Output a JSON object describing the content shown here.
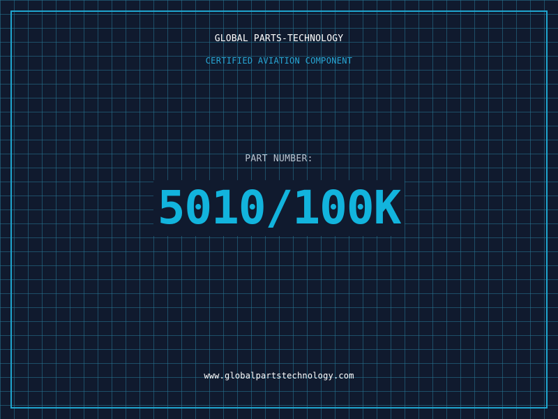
{
  "brand": "GLOBAL PARTS-TECHNOLOGY",
  "subtitle": "CERTIFIED AVIATION COMPONENT",
  "part": {
    "label": "PART NUMBER:",
    "number": "5010/100K"
  },
  "website": "www.globalpartstechnology.com",
  "colors": {
    "background": "#101a2e",
    "grid": "#28789a",
    "accent": "#12b4dd",
    "text": "#ffffff"
  }
}
